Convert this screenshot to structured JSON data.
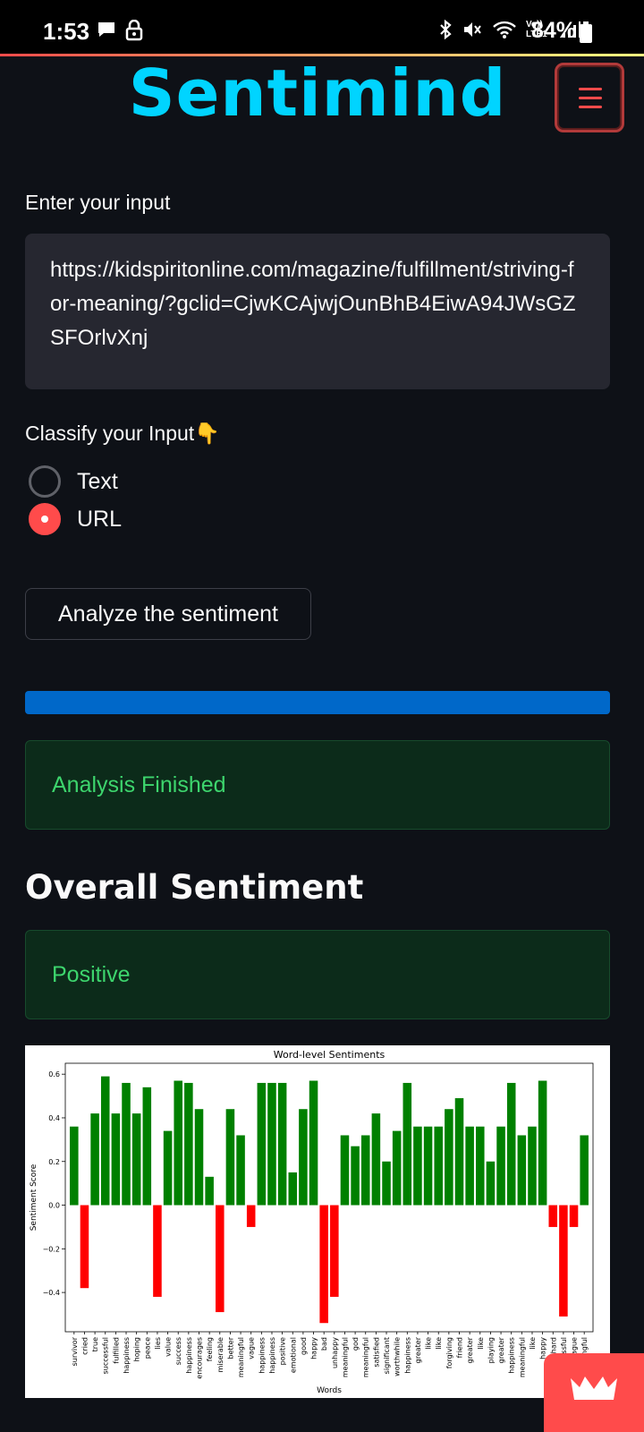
{
  "status": {
    "time": "1:53",
    "battery": "84%",
    "net": "Vo)) LTE1"
  },
  "header": {
    "brand": "Sentimind",
    "menu_icon": "hamburger-icon"
  },
  "form": {
    "input_label": "Enter your input",
    "input_value": "https://kidspiritonline.com/magazine/fulfillment/striving-for-meaning/?gclid=CjwKCAjwjOunBhB4EiwA94JWsGZSFOrlvXnj",
    "classify_label": "Classify your Input👇",
    "options": [
      "Text",
      "URL"
    ],
    "selected": "URL",
    "analyze_label": "Analyze the sentiment"
  },
  "progress": {
    "value": 1.0
  },
  "result": {
    "status_message": "Analysis Finished",
    "overall_heading": "Overall Sentiment",
    "overall_value": "Positive"
  },
  "colors": {
    "accent": "#ff4b4b",
    "brand": "#00d4ff",
    "positive": "#008000",
    "negative": "#ff0000",
    "progress": "#0068c9"
  },
  "chart_data": {
    "type": "bar",
    "title": "Word-level Sentiments",
    "xlabel": "Words",
    "ylabel": "Sentiment Score",
    "ylim": [
      -0.58,
      0.65
    ],
    "yticks": [
      -0.4,
      -0.2,
      0.0,
      0.2,
      0.4,
      0.6
    ],
    "grid": false,
    "categories": [
      "survivor",
      "cried",
      "true",
      "successful",
      "fulfilled",
      "happiness",
      "hoping",
      "peace",
      "lies",
      "value",
      "success",
      "happiness",
      "encourages",
      "feeling",
      "miserable",
      "better",
      "meaningful",
      "vague",
      "happiness",
      "happiness",
      "positive",
      "emotional",
      "good",
      "happy",
      "bad",
      "unhappy",
      "meaningful",
      "god",
      "meaningful",
      "satisfied",
      "significant",
      "worthwhile",
      "happiness",
      "greater",
      "like",
      "like",
      "forgiving",
      "friend",
      "greater",
      "like",
      "playing",
      "greater",
      "happiness",
      "meaningful",
      "like",
      "happy",
      "hard",
      "essful",
      "vague",
      "ingful"
    ],
    "values": [
      0.36,
      -0.38,
      0.42,
      0.59,
      0.42,
      0.56,
      0.42,
      0.54,
      -0.42,
      0.34,
      0.57,
      0.56,
      0.44,
      0.13,
      -0.49,
      0.44,
      0.32,
      -0.1,
      0.56,
      0.56,
      0.56,
      0.15,
      0.44,
      0.57,
      -0.54,
      -0.42,
      0.32,
      0.27,
      0.32,
      0.42,
      0.2,
      0.34,
      0.56,
      0.36,
      0.36,
      0.36,
      0.44,
      0.49,
      0.36,
      0.36,
      0.2,
      0.36,
      0.56,
      0.32,
      0.36,
      0.57,
      -0.1,
      -0.51,
      -0.1,
      0.32
    ]
  }
}
